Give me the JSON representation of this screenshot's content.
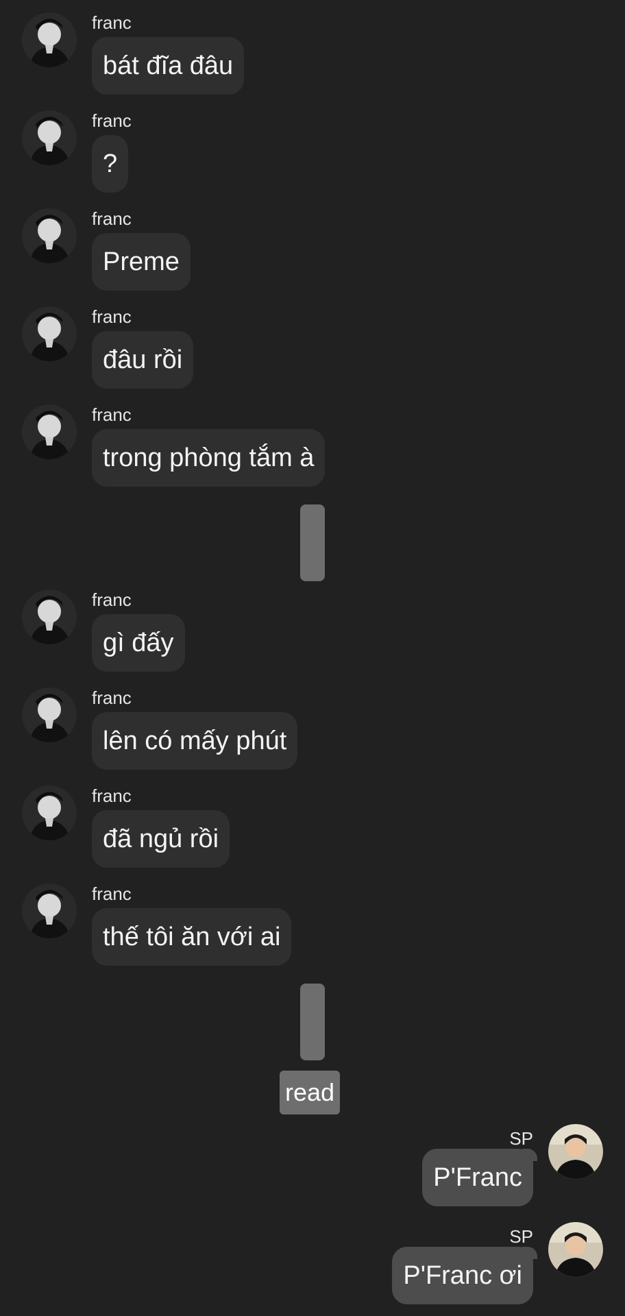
{
  "messages_before": [
    {
      "sender": "franc",
      "text": "bát đĩa đâu"
    },
    {
      "sender": "franc",
      "text": "?"
    },
    {
      "sender": "franc",
      "text": "Preme"
    },
    {
      "sender": "franc",
      "text": "đâu rồi"
    },
    {
      "sender": "franc",
      "text": "trong phòng tắm à"
    }
  ],
  "messages_middle": [
    {
      "sender": "franc",
      "text": "gì đấy"
    },
    {
      "sender": "franc",
      "text": "lên có mấy phút"
    },
    {
      "sender": "franc",
      "text": "đã ngủ rồi"
    },
    {
      "sender": "franc",
      "text": "thế tôi ăn với ai"
    }
  ],
  "read_receipt": "read",
  "messages_after": [
    {
      "sender": "SP",
      "text": "P'Franc"
    },
    {
      "sender": "SP",
      "text": "P'Franc ơi"
    }
  ],
  "colors": {
    "background": "#212121",
    "incoming_bubble": "#2f2f2f",
    "outgoing_bubble": "#4d4d4d",
    "marker": "#6e6e6e"
  },
  "icons": {
    "incoming_avatar": "person-portrait-bw",
    "outgoing_avatar": "person-portrait-color"
  }
}
